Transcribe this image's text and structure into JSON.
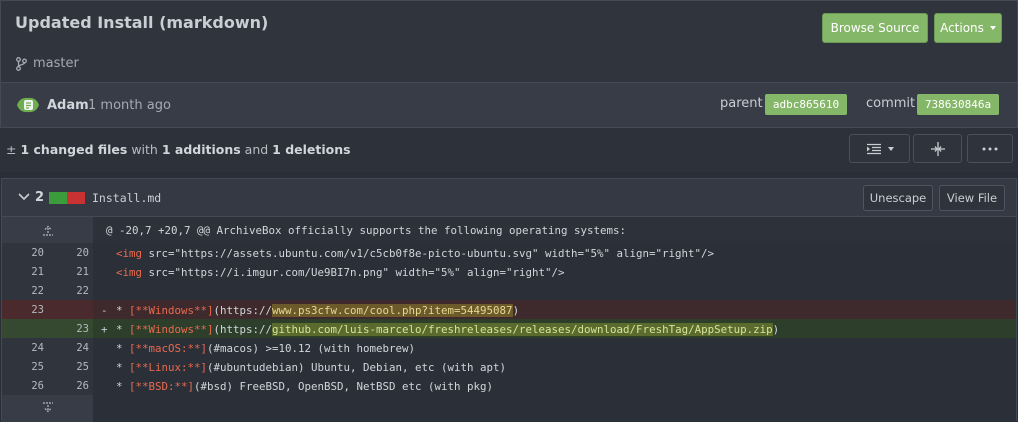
{
  "header": {
    "title": "Updated Install (markdown)",
    "branch": "master",
    "browse_source": "Browse Source",
    "actions": "Actions"
  },
  "commit": {
    "author": "Adam",
    "when": "1 month ago",
    "parent_label": "parent",
    "parent_hash": "adbc865610",
    "commit_label": "commit",
    "commit_hash": "738630846a"
  },
  "summary": {
    "changed": "1 changed files",
    "with": " with ",
    "additions": "1 additions",
    "and": " and ",
    "deletions": "1 deletions"
  },
  "file": {
    "diff_count": "2",
    "name": "Install.md",
    "unescape": "Unescape",
    "view_file": "View File",
    "hunk": "@ -20,7 +20,7 @@ ArchiveBox officially supports the following operating systems:",
    "lines": [
      {
        "old": "20",
        "new": "20",
        "sign": "",
        "type": "ctx",
        "pre": "<img",
        "attrs": " src=\"https://assets.ubuntu.com/v1/c5cb0f8e-picto-ubuntu.svg\" width=\"5%\" align=\"right\"/>"
      },
      {
        "old": "21",
        "new": "21",
        "sign": "",
        "type": "ctx",
        "pre": "<img",
        "attrs": " src=\"https://i.imgur.com/Ue9BI7n.png\" width=\"5%\" align=\"right\"/>"
      },
      {
        "old": "22",
        "new": "22",
        "sign": "",
        "type": "ctx",
        "text": ""
      },
      {
        "old": "23",
        "new": "",
        "sign": "-",
        "type": "del",
        "label": "[**Windows**]",
        "before": "(https://",
        "hl": "www.ps3cfw.com/cool.php?item=54495087",
        "after": ")"
      },
      {
        "old": "",
        "new": "23",
        "sign": "+",
        "type": "add",
        "label": "[**Windows**]",
        "before": "(https://",
        "hl": "github.com/luis-marcelo/freshreleases/releases/download/FreshTag/AppSetup.zip",
        "after": ")"
      },
      {
        "old": "24",
        "new": "24",
        "sign": "",
        "type": "md",
        "label": "[**macOS:**]",
        "rest": "(#macos) >=10.12 (with homebrew)"
      },
      {
        "old": "25",
        "new": "25",
        "sign": "",
        "type": "md",
        "label": "[**Linux:**]",
        "rest": "(#ubuntudebian) Ubuntu, Debian, etc (with apt)"
      },
      {
        "old": "26",
        "new": "26",
        "sign": "",
        "type": "md",
        "label": "[**BSD:**]",
        "rest": "(#bsd) FreeBSD, OpenBSD, NetBSD etc (with pkg)"
      }
    ]
  },
  "colors": {
    "accent_green": "#85b769",
    "deleted_bg": "#3e2a2c",
    "added_bg": "#2d3f2b"
  }
}
